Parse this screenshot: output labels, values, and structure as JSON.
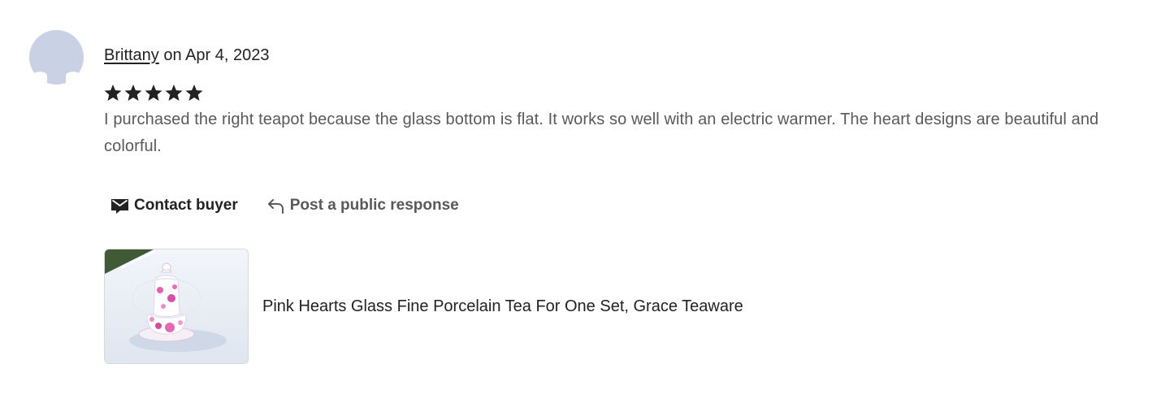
{
  "review": {
    "reviewer_name": "Brittany",
    "date_text": " on Apr 4, 2023",
    "rating": 5,
    "max_rating": 5,
    "text": "I purchased the right teapot because the glass bottom is flat. It works so well with an electric warmer. The heart designs are beautiful and colorful."
  },
  "actions": {
    "contact_label": "Contact buyer",
    "respond_label": "Post a public response"
  },
  "product": {
    "title": "Pink Hearts Glass Fine Porcelain Tea For One Set, Grace Teaware"
  },
  "icons": {
    "avatar": "user-silhouette-icon",
    "star": "star-icon",
    "contact": "envelope-icon",
    "respond": "reply-arrow-icon"
  },
  "colors": {
    "avatar_bg": "#c9d1e4",
    "text_primary": "#222222",
    "text_secondary": "#595959"
  }
}
